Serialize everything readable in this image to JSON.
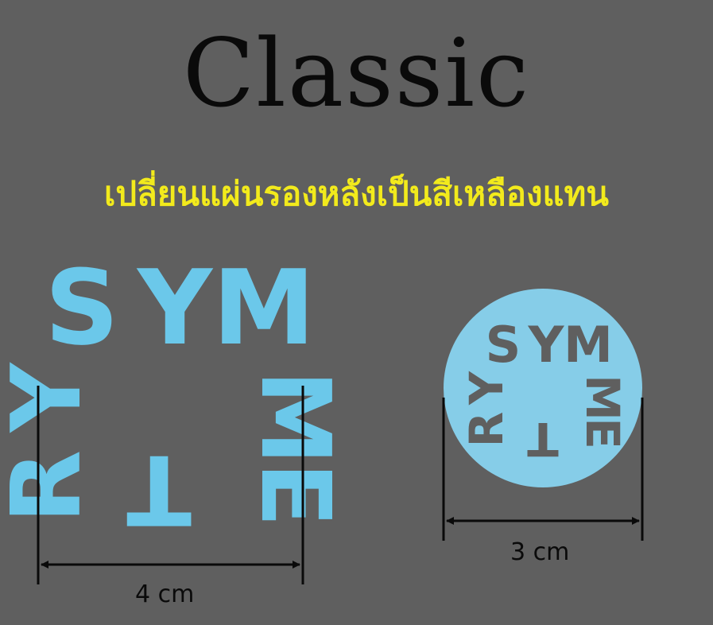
{
  "title": "Classic",
  "subtitle": "เปลี่ยนแผ่นรองหลังเป็นสีเหลืองแทน",
  "logo_text": [
    "S",
    "Y",
    "M",
    "M",
    "E",
    "T",
    "R",
    "Y"
  ],
  "square_logo": {
    "color": "#6bc8ea",
    "width_label": "4 cm"
  },
  "round_logo": {
    "disc_color": "#86cde8",
    "letter_color": "#5f5f5f",
    "width_label": "3 cm"
  },
  "colors": {
    "background": "#5f5f5f",
    "title": "#0a0a0a",
    "subtitle": "#f2ea1c",
    "dimension_lines": "#0a0a0a"
  }
}
